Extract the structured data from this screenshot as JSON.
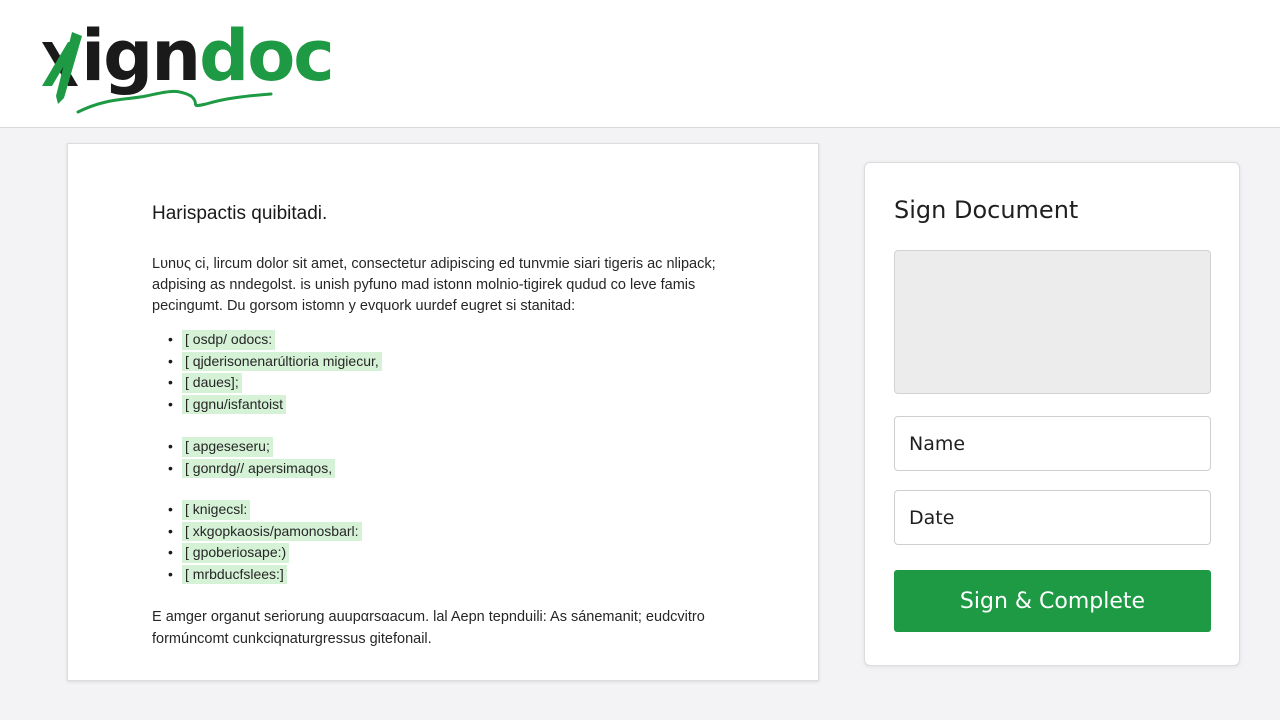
{
  "header": {
    "logo": {
      "prefix": "x",
      "dark_part": "ign",
      "green_part": "doc",
      "accent_color": "#1e9a44",
      "dark_color": "#1a1a1a"
    }
  },
  "document": {
    "title": "Harispactis quibitadi.",
    "intro_lines": [
      "Lυnυς ci, lircum dolor sit amet, consectetur adipiscing ed tunvmie siari tigeris ac nlipack;",
      "adpising as nndegolst. is unish pyfuno mad istonn molnio-tigirek qudud co leve famis",
      "pecingumt. Du gorsom istomn y evquork uurdef eugret si stanitad:"
    ],
    "bullet_groups": [
      [
        "[ osdp/ odocs:",
        "[ qjderisonenarúltioria migiecur,",
        "[ daues];",
        "[ ggnu/isfantoist"
      ],
      [
        "[ apgeseseru;",
        "[ gonrdg// apersimaqos,"
      ],
      [
        "[ knigecsl:",
        "[ xkgopkaosis/pamonosbarl:",
        "[ gpoberiosape:)",
        "[ mrbducfslees:]"
      ]
    ],
    "footer_lines": [
      "E amger organut seriorung auupαrsαacum. lal Aepn tepnduili: As sánemanit; eudcvitro",
      "formúncomt cunkciqnaturgressus gitefonail."
    ],
    "highlight_color": "#d5f2d7"
  },
  "sign_panel": {
    "title": "Sign Document",
    "name_placeholder": "Name",
    "date_placeholder": "Date",
    "submit_label": "Sign & Complete",
    "button_color": "#1e9a44"
  }
}
